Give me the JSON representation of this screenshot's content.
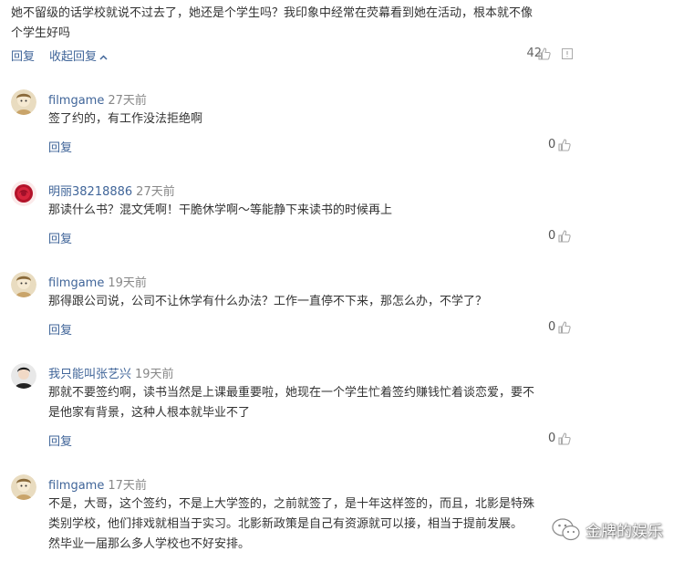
{
  "top_comment": {
    "text_line1": "她不留级的话学校就说不过去了，她还是个学生吗？我印象中经常在荧幕看到她在活动，根本就不像",
    "text_line2": "个学生好吗",
    "reply_label": "回复",
    "collapse_label": "收起回复",
    "likes": "42"
  },
  "comments": [
    {
      "user": "filmgame",
      "time": "27天前",
      "text": "签了约的，有工作没法拒绝啊",
      "reply_label": "回复",
      "likes": "0",
      "avatar": "cartoon-avatar"
    },
    {
      "user": "明丽38218886",
      "time": "27天前",
      "text": "那读什么书？混文凭啊！干脆休学啊～等能静下来读书的时候再上",
      "reply_label": "回复",
      "likes": "0",
      "avatar": "rose-avatar"
    },
    {
      "user": "filmgame",
      "time": "19天前",
      "text": "那得跟公司说，公司不让休学有什么办法？工作一直停不下来，那怎么办，不学了？",
      "reply_label": "回复",
      "likes": "0",
      "avatar": "cartoon-avatar"
    },
    {
      "user": "我只能叫张艺兴",
      "time": "19天前",
      "text_line1": "那就不要签约啊，读书当然是上课最重要啦，她现在一个学生忙着签约赚钱忙着谈恋爱，要不",
      "text_line2": "是他家有背景，这种人根本就毕业不了",
      "reply_label": "回复",
      "likes": "0",
      "avatar": "person-avatar"
    },
    {
      "user": "filmgame",
      "time": "17天前",
      "text_line1": "不是，大哥，这个签约，不是上大学签的，之前就签了，是十年这样签的，而且，北影是特殊",
      "text_line2": "类别学校，他们排戏就相当于实习。北影新政策是自己有资源就可以接，相当于提前发展。",
      "text_line3": "然毕业一届那么多人学校也不好安排。",
      "avatar": "cartoon-avatar"
    }
  ],
  "watermark": {
    "text": "金牌的娱乐",
    "icon": "wechat-logo"
  }
}
